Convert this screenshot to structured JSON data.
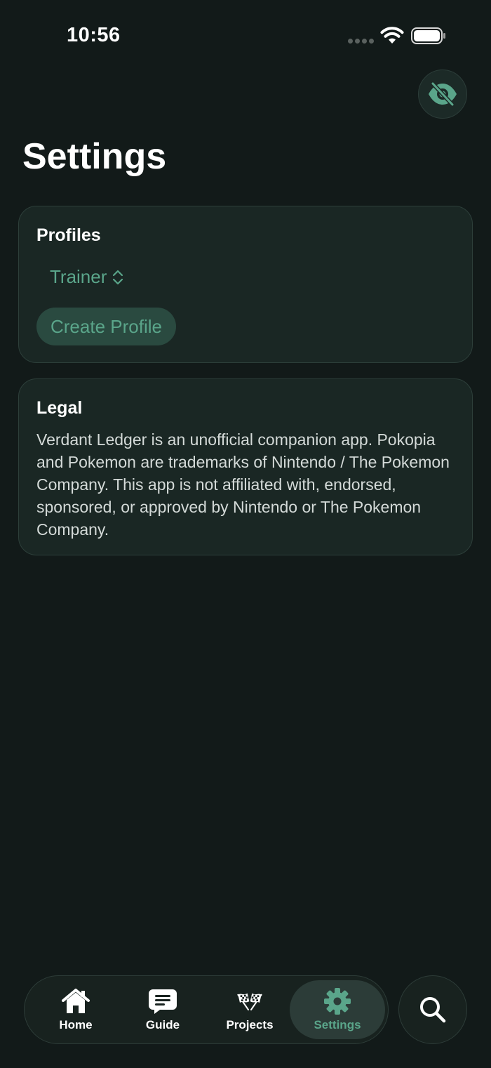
{
  "status_bar": {
    "time": "10:56"
  },
  "header": {
    "title": "Settings",
    "visibility_toggle_icon": "eye-slash-icon"
  },
  "profiles_card": {
    "heading": "Profiles",
    "selected_profile": "Trainer",
    "create_button_label": "Create Profile"
  },
  "legal_card": {
    "heading": "Legal",
    "text": "Verdant Ledger is an unofficial companion app. Pokopia and Pokemon are trademarks of Nintendo / The Pokemon Company. This app is not affiliated with, endorsed, sponsored, or approved by Nintendo or The Pokemon Company."
  },
  "tab_bar": {
    "tabs": [
      {
        "label": "Home",
        "icon": "house-icon",
        "selected": false
      },
      {
        "label": "Guide",
        "icon": "speech-bubble-icon",
        "selected": false
      },
      {
        "label": "Projects",
        "icon": "checkered-flags-icon",
        "selected": false
      },
      {
        "label": "Settings",
        "icon": "gear-icon",
        "selected": true
      }
    ],
    "search_icon": "magnifying-glass-icon"
  },
  "colors": {
    "background": "#121a19",
    "card": "#1a2724",
    "accent": "#5aa58a",
    "text_secondary": "#d4dad8"
  }
}
